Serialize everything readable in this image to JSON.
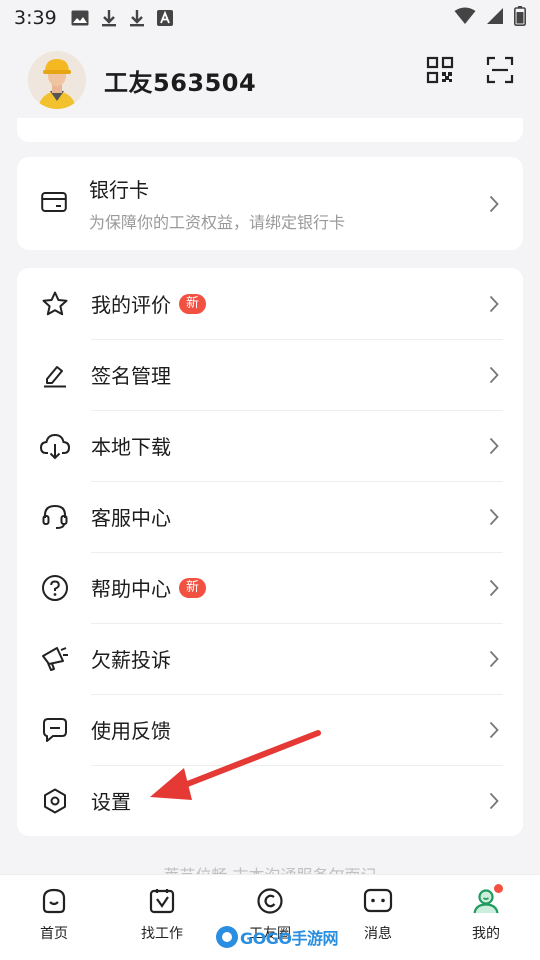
{
  "status_bar": {
    "time": "3:39"
  },
  "profile": {
    "username": "工友563504"
  },
  "bank_card": {
    "title": "银行卡",
    "subtitle": "为保障你的工资权益，请绑定银行卡"
  },
  "menu": {
    "items": [
      {
        "label": "我的评价",
        "badge": "新",
        "icon": "star-icon"
      },
      {
        "label": "签名管理",
        "icon": "pen-icon"
      },
      {
        "label": "本地下载",
        "icon": "cloud-download-icon"
      },
      {
        "label": "客服中心",
        "icon": "headset-icon"
      },
      {
        "label": "帮助中心",
        "badge": "新",
        "icon": "question-icon"
      },
      {
        "label": "欠薪投诉",
        "icon": "megaphone-icon"
      },
      {
        "label": "使用反馈",
        "icon": "feedback-icon"
      },
      {
        "label": "设置",
        "icon": "settings-icon"
      }
    ]
  },
  "footer_hint": "莱艺位畅 古本沟通服务尔面记",
  "tabbar": {
    "tabs": [
      {
        "label": "首页",
        "icon": "home-icon"
      },
      {
        "label": "找工作",
        "icon": "job-icon"
      },
      {
        "label": "工友圈",
        "icon": "circle-icon"
      },
      {
        "label": "消息",
        "icon": "message-icon"
      },
      {
        "label": "我的",
        "icon": "profile-icon"
      }
    ]
  },
  "watermark": "GOGO手游网",
  "colors": {
    "badge": "#f25041",
    "annotation_arrow": "#e53935",
    "background": "#f4f4f6"
  }
}
